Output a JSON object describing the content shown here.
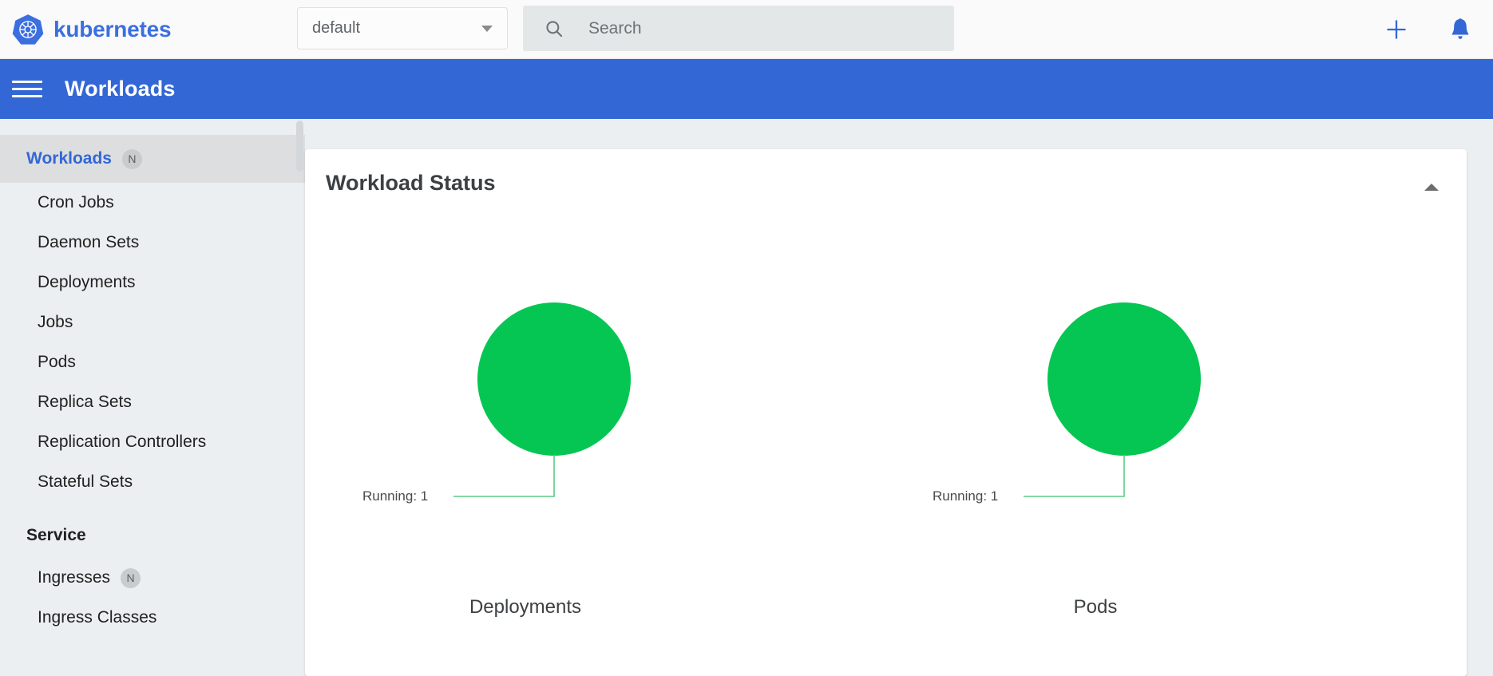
{
  "header": {
    "brand": "kubernetes",
    "logo_icon": "kubernetes-helm-icon",
    "namespace_selector": {
      "value": "default",
      "caret_icon": "chevron-down-icon"
    },
    "search": {
      "icon": "search-icon",
      "placeholder": "Search",
      "value": ""
    },
    "actions": [
      {
        "icon": "plus-icon",
        "name": "create-resource-button",
        "color": "#3367d6"
      },
      {
        "icon": "bell-icon",
        "name": "notifications-button",
        "color": "#3367d6"
      }
    ]
  },
  "toolbar": {
    "menu_icon": "hamburger-menu-icon",
    "title": "Workloads",
    "background": "#3367d6"
  },
  "sidebar": {
    "items": [
      {
        "label": "Workloads",
        "badge": "N",
        "active": true,
        "group": false
      },
      {
        "label": "Cron Jobs",
        "badge": "",
        "active": false,
        "group": false
      },
      {
        "label": "Daemon Sets",
        "badge": "",
        "active": false,
        "group": false
      },
      {
        "label": "Deployments",
        "badge": "",
        "active": false,
        "group": false
      },
      {
        "label": "Jobs",
        "badge": "",
        "active": false,
        "group": false
      },
      {
        "label": "Pods",
        "badge": "",
        "active": false,
        "group": false
      },
      {
        "label": "Replica Sets",
        "badge": "",
        "active": false,
        "group": false
      },
      {
        "label": "Replication Controllers",
        "badge": "",
        "active": false,
        "group": false
      },
      {
        "label": "Stateful Sets",
        "badge": "",
        "active": false,
        "group": false
      }
    ],
    "groups": [
      {
        "title": "Service"
      }
    ],
    "service_items": [
      {
        "label": "Ingresses",
        "badge": "N"
      },
      {
        "label": "Ingress Classes",
        "badge": ""
      }
    ],
    "active_color": "#3367d6",
    "active_background": "#dcdedf"
  },
  "card": {
    "title": "Workload Status",
    "collapse_icon": "chevron-up-icon"
  },
  "chart_data": [
    {
      "type": "pie",
      "title": "Deployments",
      "categories": [
        "Running"
      ],
      "values": [
        1
      ],
      "colors": [
        "#05c652"
      ],
      "annotations": [
        "Running: 1"
      ],
      "legend": "none",
      "grid": false
    },
    {
      "type": "pie",
      "title": "Pods",
      "categories": [
        "Running"
      ],
      "values": [
        1
      ],
      "colors": [
        "#05c652"
      ],
      "annotations": [
        "Running: 1"
      ],
      "legend": "none",
      "grid": false
    }
  ]
}
